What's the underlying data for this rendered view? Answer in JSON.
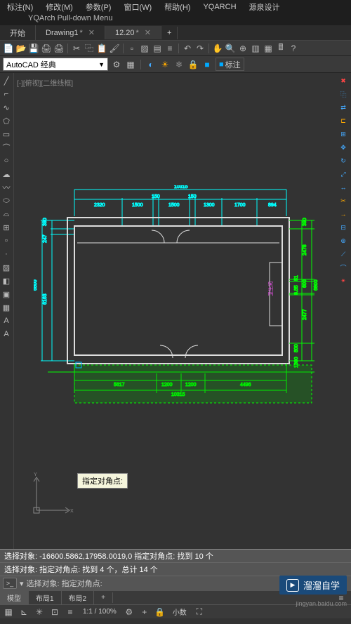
{
  "menubar": {
    "items": [
      "标注(N)",
      "修改(M)",
      "参数(P)",
      "窗口(W)",
      "帮助(H)",
      "YQARCH",
      "源泉设计"
    ]
  },
  "subtitle": "YQArch Pull-down Menu",
  "file_tabs": {
    "t0": "开始",
    "t1": "Drawing1",
    "t2": "12.20",
    "add": "+"
  },
  "workspace_dd": "AutoCAD 经典",
  "annot_label": "标注",
  "viewport_label": {
    "a": "[-]",
    "b": "[俯视]",
    "c": "[二维线框]"
  },
  "tooltip": "指定对角点:",
  "axis": {
    "x": "X",
    "y": "Y"
  },
  "drawing": {
    "top_total": "10315",
    "top_dims": [
      "2320",
      "1500",
      "150",
      "1500",
      "150",
      "1300",
      "1700",
      "894"
    ],
    "left_dims": [
      "390",
      "247",
      "6163"
    ],
    "left_total": "6800",
    "right_dims": [
      "390",
      "2478",
      "51",
      "600",
      "6.85",
      "2477",
      "800",
      "1300"
    ],
    "right_total": "6800",
    "bottom_dims": [
      "5617",
      "1200",
      "1200",
      "4496"
    ],
    "bottom_total": "10315",
    "room_label": "卫生间"
  },
  "cmd": {
    "line1": "选择对象: -16600.5862,17958.0019,0 指定对角点: 找到 10 个",
    "line2": "选择对象: 指定对角点: 找到 4 个，总计 14 个",
    "prompt": "选择对象: 指定对角点:"
  },
  "bottom_tabs": {
    "t0": "模型",
    "t1": "布局1",
    "t2": "布局2",
    "add": "+"
  },
  "status": {
    "scale": "1:1 / 100%",
    "decimal": "小数"
  },
  "watermark": "溜溜自学",
  "url": "jingyan.baidu.com"
}
